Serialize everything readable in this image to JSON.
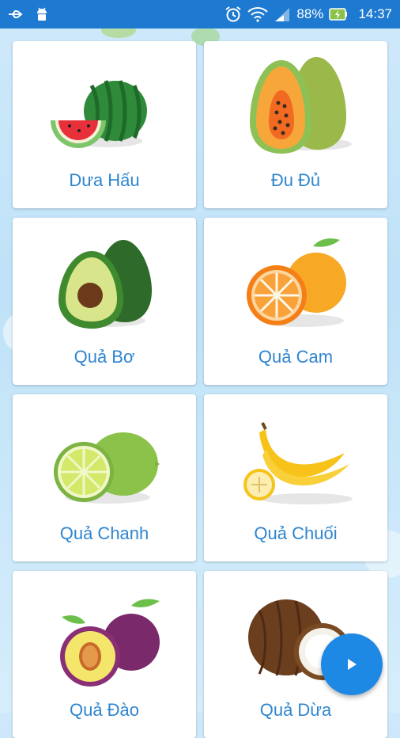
{
  "status_bar": {
    "battery": "88%",
    "time": "14:37",
    "icons": [
      "usb-icon",
      "android-icon",
      "alarm-icon",
      "wifi-icon",
      "signal-icon",
      "battery-charging-icon"
    ]
  },
  "fruits": [
    {
      "label": "Dưa Hấu",
      "icon": "watermelon-icon"
    },
    {
      "label": "Đu Đủ",
      "icon": "papaya-icon"
    },
    {
      "label": "Quả Bơ",
      "icon": "avocado-icon"
    },
    {
      "label": "Quả Cam",
      "icon": "orange-icon"
    },
    {
      "label": "Quả Chanh",
      "icon": "lime-icon"
    },
    {
      "label": "Quả Chuối",
      "icon": "banana-icon"
    },
    {
      "label": "Quả Đào",
      "icon": "peach-icon"
    },
    {
      "label": "Quả Dừa",
      "icon": "coconut-icon"
    }
  ],
  "fab": {
    "icon": "play-icon"
  },
  "colors": {
    "status_bar": "#1e7ad0",
    "label": "#2f86cf",
    "fab": "#1e88e5"
  }
}
